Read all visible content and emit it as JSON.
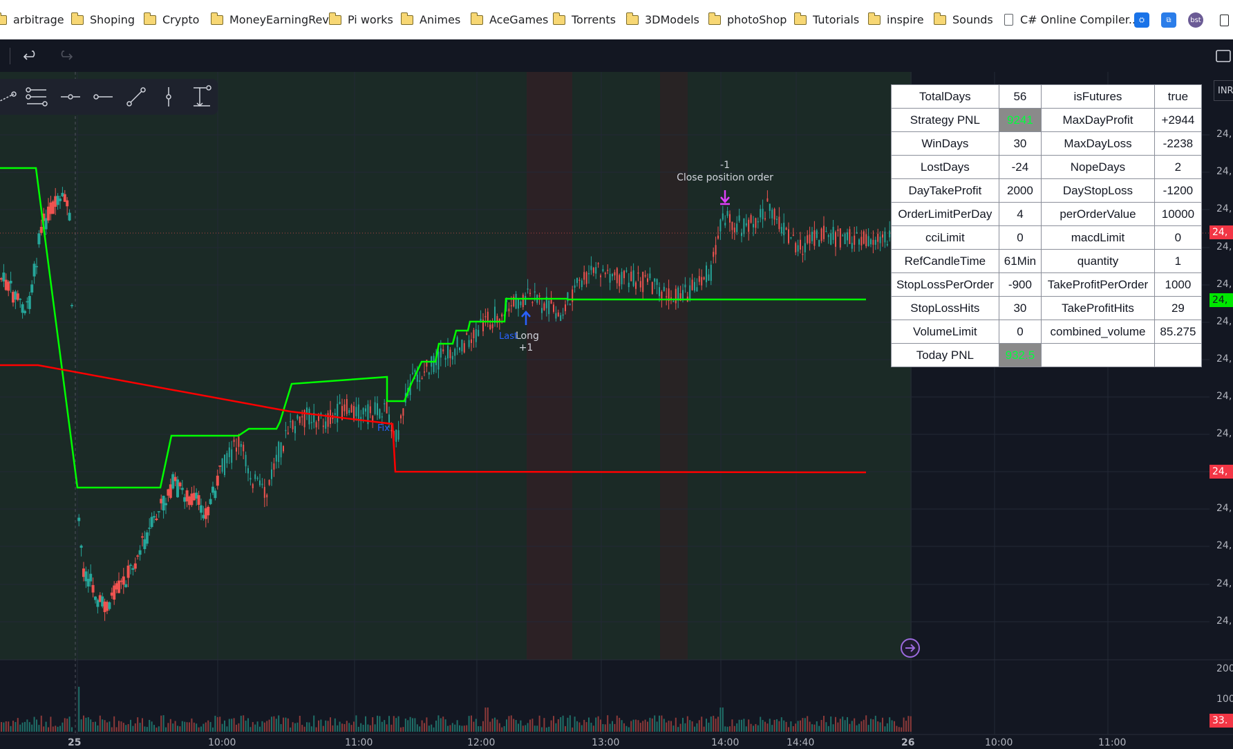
{
  "bookmarks_bar": {
    "items": [
      {
        "label": "arbitrage",
        "type": "folder"
      },
      {
        "label": "Shoping",
        "type": "folder"
      },
      {
        "label": "Crypto",
        "type": "folder"
      },
      {
        "label": "MoneyEarningRev",
        "type": "folder"
      },
      {
        "label": "Pi works",
        "type": "folder"
      },
      {
        "label": "Animes",
        "type": "folder"
      },
      {
        "label": "AceGames",
        "type": "folder"
      },
      {
        "label": "Torrents",
        "type": "folder"
      },
      {
        "label": "3DModels",
        "type": "folder"
      },
      {
        "label": "photoShop",
        "type": "folder"
      },
      {
        "label": "Tutorials",
        "type": "folder"
      },
      {
        "label": "inspire",
        "type": "folder"
      },
      {
        "label": "Sounds",
        "type": "folder"
      },
      {
        "label": "C# Online Compiler...",
        "type": "page"
      }
    ]
  },
  "toolbar": {
    "undo_icon": "undo-icon",
    "redo_icon": "redo-icon",
    "fullscreen_icon": "fullscreen-icon"
  },
  "chart": {
    "currency_label": "INR",
    "price_axis_labels": [
      "24,",
      "24,",
      "24,",
      "24,",
      "24,",
      "24,",
      "24,",
      "24,",
      "24,",
      "24,",
      "24,",
      "24,",
      "24,",
      "24,"
    ],
    "price_tags": [
      {
        "text": "24,",
        "color": "#f23645"
      },
      {
        "text": "24,",
        "color": "#00e600"
      },
      {
        "text": "24,",
        "color": "#f23645"
      },
      {
        "text": "33.",
        "color": "#f23645"
      }
    ],
    "volume_axis_labels": [
      "200",
      "100"
    ],
    "time_labels": [
      "25",
      "10:00",
      "11:00",
      "12:00",
      "13:00",
      "14:00",
      "14:40",
      "26",
      "10:00",
      "11:00"
    ],
    "annotations": {
      "close_order_qty": "-1",
      "close_order_label": "Close position order",
      "long_label": "Long",
      "long_qty": "+1",
      "last_label": "Last",
      "fix_label": "Fix"
    },
    "colors": {
      "up": "#26a69a",
      "down": "#ef5350",
      "green_line": "#00ff00",
      "red_line": "#ff0000",
      "background": "#131722"
    }
  },
  "stats_table": {
    "rows": [
      [
        "TotalDays",
        "56",
        "isFutures",
        "true"
      ],
      [
        "Strategy PNL",
        "9241",
        "MaxDayProfit",
        "+2944"
      ],
      [
        "WinDays",
        "30",
        "MaxDayLoss",
        "-2238"
      ],
      [
        "LostDays",
        "-24",
        "NopeDays",
        "2"
      ],
      [
        "DayTakeProfit",
        "2000",
        "DayStopLoss",
        "-1200"
      ],
      [
        "OrderLimitPerDay",
        "4",
        "perOrderValue",
        "10000"
      ],
      [
        "cciLimit",
        "0",
        "macdLimit",
        "0"
      ],
      [
        "RefCandleTime",
        "61Min",
        "quantity",
        "1"
      ],
      [
        "StopLossPerOrder",
        "-900",
        "TakeProfitPerOrder",
        "1000"
      ],
      [
        "StopLossHits",
        "30",
        "TakeProfitHits",
        "29"
      ],
      [
        "VolumeLimit",
        "0",
        "combined_volume",
        "85.275"
      ],
      [
        "Today PNL",
        "932.5",
        "",
        ""
      ]
    ]
  }
}
